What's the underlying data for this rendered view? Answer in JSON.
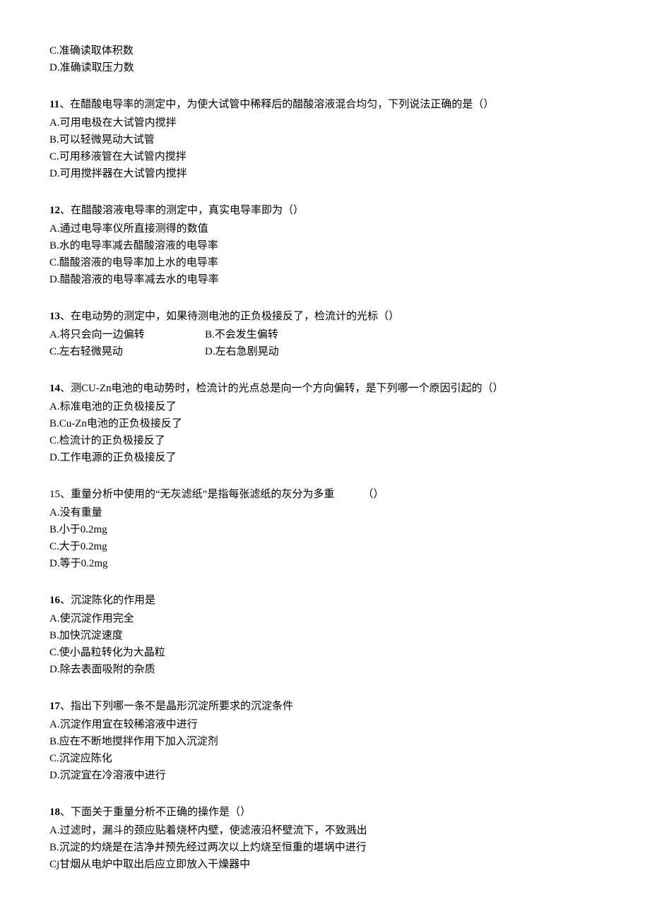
{
  "q10_partial": {
    "opts": [
      "C.准确读取体积数",
      "D.准确读取压力数"
    ]
  },
  "q11": {
    "num": "11",
    "sep": "、",
    "stem": "在醋酸电导率的测定中，为使大试管中稀释后的醋酸溶液混合均匀，下列说法正确的是（）",
    "opts": [
      "A.可用电极在大试管内搅拌",
      "B.可以轻微晃动大试管",
      "C.可用移液管在大试管内搅拌",
      "D.可用搅拌器在大试管内搅拌"
    ]
  },
  "q12": {
    "num": "12",
    "sep": "、",
    "stem": "在醋酸溶液电导率的测定中，真实电导率即为（）",
    "opts": [
      "A.通过电导率仪所直接测得的数值",
      "B.水的电导率减去醋酸溶液的电导率",
      "C.醋酸溶液的电导率加上水的电导率",
      "D.醋酸溶液的电导率减去水的电导率"
    ]
  },
  "q13": {
    "num": "13",
    "sep": "、",
    "stem": "在电动势的测定中，如果待测电池的正负极接反了，检流计的光标（）",
    "inline": [
      {
        "a": "A.将只会向一边偏转",
        "b": "B.不会发生偏转"
      },
      {
        "a": "C.左右轻微晃动",
        "b": "D.左右急剧晃动"
      }
    ]
  },
  "q14": {
    "num": "14",
    "sep": "、",
    "stem": "测CU-Zn电池的电动势时，检流计的光点总是向一个方向偏转，是下列哪一个原因引起的（）",
    "opts": [
      "A.标准电池的正负极接反了",
      "B.Cu-Zn电池的正负极接反了",
      "C.检流计的正负极接反了",
      "D.工作电源的正负极接反了"
    ]
  },
  "q15": {
    "num": "15、",
    "stem": "重量分析中使用的“无灰滤纸”是指每张滤纸的灰分为多重",
    "bracket": "（）",
    "opts": [
      "A.没有重量",
      "B.小于0.2mg",
      "C.大于0.2mg",
      "D.等于0.2mg"
    ]
  },
  "q16": {
    "num": "16",
    "sep": "、",
    "stem": "沉淀陈化的作用是",
    "opts": [
      "A.使沉淀作用完全",
      "B.加快沉淀速度",
      "C.使小晶粒转化为大晶粒",
      "D.除去表面吸附的杂质"
    ]
  },
  "q17": {
    "num": "17",
    "sep": "、",
    "stem": "指出下列哪一条不是晶形沉淀所要求的沉淀条件",
    "opts": [
      "A.沉淀作用宜在较稀溶液中进行",
      "B.应在不断地搅拌作用下加入沉淀剂",
      "C.沉淀应陈化",
      "D.沉淀宜在冷溶液中进行"
    ]
  },
  "q18": {
    "num": "18",
    "sep": "、",
    "stem": "下面关于重量分析不正确的操作是（）",
    "opts": [
      "A.过滤时，漏斗的颈应贴着烧杯内壁，使滤液沿杯壁流下，不致溅出",
      "B.沉淀的灼烧是在洁净并预先经过两次以上灼烧至恒重的堪埚中进行",
      "Cj甘烟从电炉中取出后应立即放入干燥器中"
    ]
  }
}
